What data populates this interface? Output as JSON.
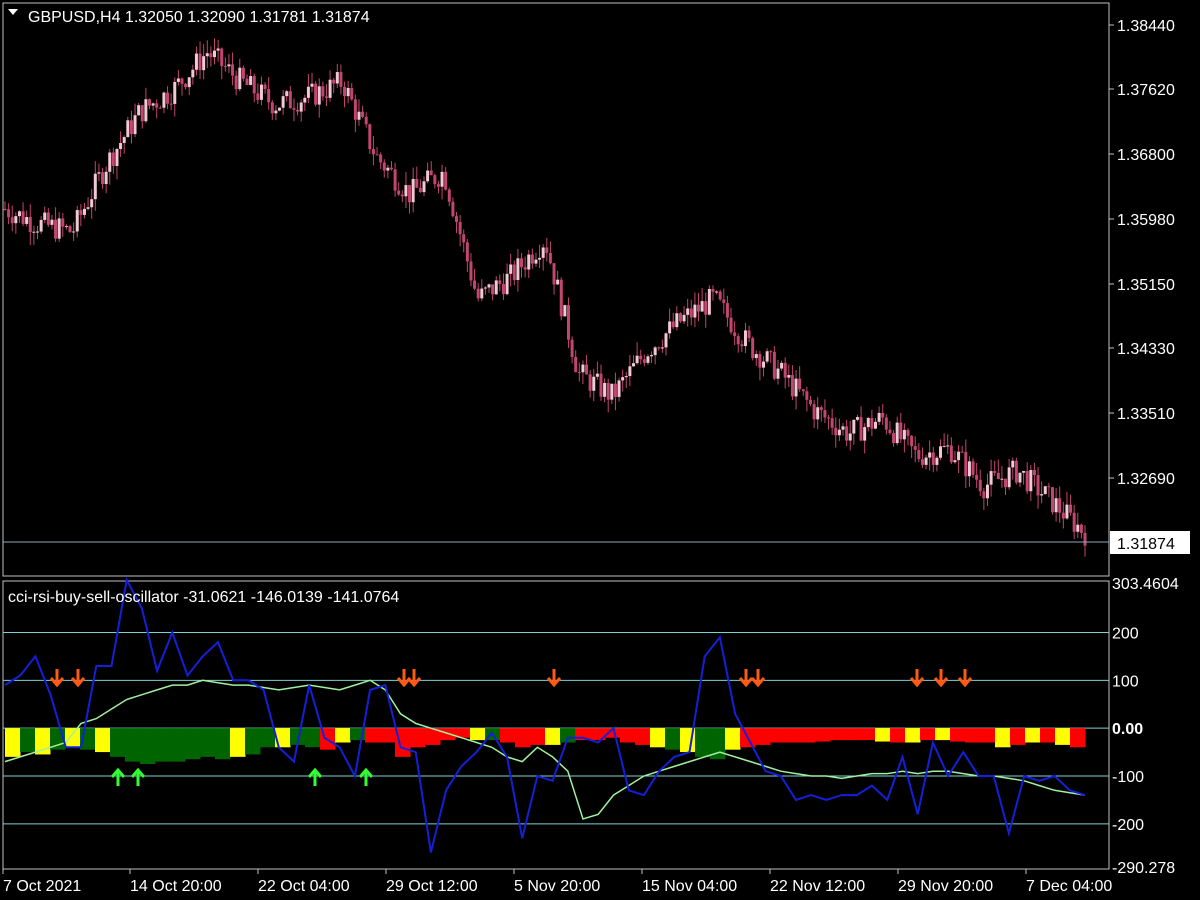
{
  "price_pane": {
    "title": "GBPUSD,H4  1.32050 1.32090 1.31781 1.31874",
    "current_price": "1.31874",
    "axis_labels": [
      "1.38440",
      "1.37620",
      "1.36800",
      "1.35980",
      "1.35150",
      "1.34330",
      "1.33510",
      "1.32690"
    ]
  },
  "indicator_pane": {
    "title": "cci-rsi-buy-sell-oscillator -31.0621 -146.0139 -141.0764",
    "axis_labels": [
      "303.4604",
      "200",
      "100",
      "0.00",
      "-100",
      "-200",
      "-290.278"
    ]
  },
  "time_axis": {
    "labels": [
      "7 Oct 2021",
      "14 Oct 20:00",
      "22 Oct 04:00",
      "29 Oct 12:00",
      "5 Nov 20:00",
      "15 Nov 04:00",
      "22 Nov 12:00",
      "29 Nov 20:00",
      "7 Dec 04:00"
    ]
  },
  "colors": {
    "background": "#000000",
    "candle": "#c2466e",
    "candle_light": "#f0c8d8",
    "cci_line": "#1420d8",
    "rsi_line": "#a0f0a0",
    "hist_red": "#ff0000",
    "hist_yellow": "#ffff00",
    "hist_green": "#006400",
    "arrow_sell": "#ff5a14",
    "arrow_buy": "#32ff32",
    "level_line": "#7fd0d0"
  },
  "chart_data": [
    {
      "type": "candlestick",
      "title": "GBPUSD,H4",
      "ylim": [
        1.314,
        1.387
      ],
      "x_range": [
        "7 Oct 2021",
        "10 Dec 2021"
      ],
      "ohlc_last": {
        "open": 1.3205,
        "high": 1.3209,
        "low": 1.31781,
        "close": 1.31874
      },
      "close_path": [
        {
          "x": "7 Oct 2021",
          "y": 1.362
        },
        {
          "x": "9 Oct",
          "y": 1.36
        },
        {
          "x": "12 Oct",
          "y": 1.359
        },
        {
          "x": "14 Oct",
          "y": 1.368
        },
        {
          "x": "16 Oct",
          "y": 1.375
        },
        {
          "x": "19 Oct",
          "y": 1.378
        },
        {
          "x": "20 Oct",
          "y": 1.383
        },
        {
          "x": "22 Oct",
          "y": 1.379
        },
        {
          "x": "25 Oct",
          "y": 1.376
        },
        {
          "x": "27 Oct",
          "y": 1.377
        },
        {
          "x": "28 Oct",
          "y": 1.379
        },
        {
          "x": "29 Oct",
          "y": 1.369
        },
        {
          "x": "1 Nov",
          "y": 1.364
        },
        {
          "x": "3 Nov",
          "y": 1.367
        },
        {
          "x": "5 Nov",
          "y": 1.35
        },
        {
          "x": "8 Nov",
          "y": 1.353
        },
        {
          "x": "9 Nov",
          "y": 1.358
        },
        {
          "x": "11 Nov",
          "y": 1.34
        },
        {
          "x": "12 Nov",
          "y": 1.337
        },
        {
          "x": "15 Nov",
          "y": 1.343
        },
        {
          "x": "17 Nov",
          "y": 1.347
        },
        {
          "x": "18 Nov",
          "y": 1.35
        },
        {
          "x": "19 Nov",
          "y": 1.344
        },
        {
          "x": "22 Nov",
          "y": 1.34
        },
        {
          "x": "24 Nov",
          "y": 1.335
        },
        {
          "x": "26 Nov",
          "y": 1.332
        },
        {
          "x": "29 Nov",
          "y": 1.334
        },
        {
          "x": "30 Nov",
          "y": 1.329
        },
        {
          "x": "1 Dec",
          "y": 1.33
        },
        {
          "x": "3 Dec",
          "y": 1.325
        },
        {
          "x": "6 Dec",
          "y": 1.327
        },
        {
          "x": "8 Dec",
          "y": 1.323
        },
        {
          "x": "10 Dec",
          "y": 1.3187
        }
      ]
    },
    {
      "type": "line",
      "title": "cci-rsi-buy-sell-oscillator",
      "ylim": [
        -290.278,
        303.4604
      ],
      "levels": [
        200,
        100,
        0,
        -100,
        -200
      ],
      "series": [
        {
          "name": "",
          "color": "#1420d8",
          "values": [
            90,
            110,
            150,
            70,
            -40,
            -40,
            130,
            130,
            310,
            250,
            120,
            200,
            110,
            150,
            180,
            100,
            100,
            80,
            -40,
            -70,
            90,
            -20,
            -40,
            -100,
            80,
            90,
            -40,
            -50,
            -260,
            -130,
            -80,
            -50,
            -10,
            -60,
            -230,
            -100,
            -110,
            -20,
            -20,
            -30,
            0,
            -130,
            -140,
            -90,
            -60,
            -50,
            150,
            190,
            30,
            -30,
            -90,
            -100,
            -150,
            -140,
            -150,
            -140,
            -140,
            -120,
            -150,
            -60,
            -180,
            -30,
            -100,
            -50,
            -100,
            -100,
            -220,
            -100,
            -110,
            -100,
            -130,
            -140
          ]
        },
        {
          "name": "",
          "color": "#a0f0a0",
          "values": [
            -70,
            -60,
            -50,
            -40,
            -30,
            10,
            20,
            40,
            60,
            70,
            80,
            90,
            90,
            100,
            95,
            90,
            90,
            85,
            80,
            85,
            90,
            85,
            80,
            90,
            100,
            80,
            30,
            10,
            0,
            -10,
            -20,
            -30,
            -40,
            -60,
            -70,
            -40,
            -60,
            -90,
            -190,
            -180,
            -140,
            -120,
            -100,
            -90,
            -80,
            -70,
            -60,
            -50,
            -60,
            -70,
            -80,
            -90,
            -95,
            -100,
            -100,
            -105,
            -100,
            -95,
            -95,
            -90,
            -95,
            -90,
            -90,
            -95,
            -100,
            -100,
            -105,
            -110,
            -120,
            -130,
            -135,
            -140
          ]
        }
      ],
      "histogram": {
        "values": [
          -60,
          -50,
          -55,
          -45,
          -40,
          -45,
          -50,
          -60,
          -70,
          -75,
          -70,
          -70,
          -65,
          -60,
          -65,
          -60,
          -55,
          -40,
          -40,
          -35,
          -40,
          -45,
          -30,
          -25,
          -30,
          -30,
          -60,
          -40,
          -35,
          -25,
          -20,
          -25,
          -25,
          -30,
          -40,
          -35,
          -35,
          -30,
          -25,
          -25,
          -20,
          -30,
          -35,
          -40,
          -45,
          -50,
          -60,
          -65,
          -45,
          -40,
          -35,
          -30,
          -30,
          -30,
          -28,
          -25,
          -25,
          -25,
          -28,
          -30,
          -30,
          -25,
          -25,
          -28,
          -30,
          -30,
          -40,
          -35,
          -30,
          -30,
          -35,
          -40
        ],
        "colors": [
          "yellow",
          "green",
          "yellow",
          "green",
          "yellow",
          "green",
          "yellow",
          "green",
          "green",
          "green",
          "green",
          "green",
          "green",
          "green",
          "green",
          "yellow",
          "green",
          "green",
          "yellow",
          "green",
          "green",
          "red",
          "yellow",
          "green",
          "red",
          "red",
          "red",
          "red",
          "red",
          "red",
          "red",
          "yellow",
          "green",
          "red",
          "red",
          "red",
          "yellow",
          "green",
          "red",
          "red",
          "red",
          "red",
          "red",
          "yellow",
          "green",
          "yellow",
          "green",
          "green",
          "yellow",
          "red",
          "red",
          "red",
          "red",
          "red",
          "red",
          "red",
          "red",
          "red",
          "yellow",
          "red",
          "yellow",
          "red",
          "yellow",
          "red",
          "red",
          "red",
          "yellow",
          "red",
          "yellow",
          "red",
          "yellow",
          "red"
        ]
      },
      "signals": {
        "sell_arrows": [
          "10 Oct",
          "11 Oct",
          "29 Oct",
          "29 Oct",
          "8 Nov",
          "19 Nov",
          "19 Nov",
          "30 Nov",
          "1 Dec",
          "2 Dec"
        ],
        "buy_arrows": [
          "14 Oct",
          "15 Oct",
          "22 Oct",
          "27 Oct"
        ]
      }
    }
  ]
}
